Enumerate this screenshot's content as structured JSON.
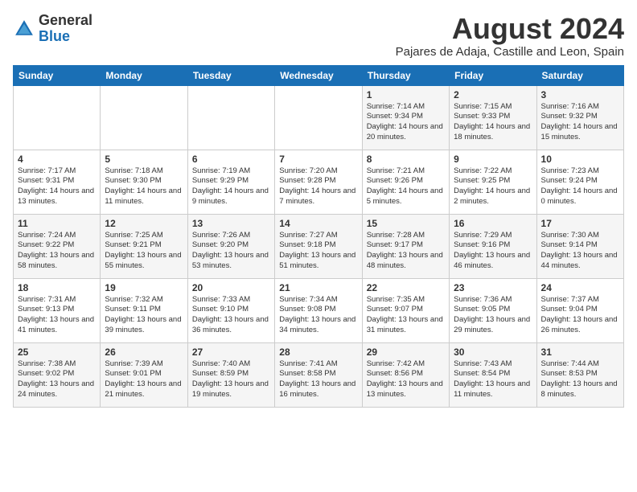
{
  "header": {
    "logo_general": "General",
    "logo_blue": "Blue",
    "month_year": "August 2024",
    "location": "Pajares de Adaja, Castille and Leon, Spain"
  },
  "weekdays": [
    "Sunday",
    "Monday",
    "Tuesday",
    "Wednesday",
    "Thursday",
    "Friday",
    "Saturday"
  ],
  "weeks": [
    [
      {
        "day": "",
        "info": ""
      },
      {
        "day": "",
        "info": ""
      },
      {
        "day": "",
        "info": ""
      },
      {
        "day": "",
        "info": ""
      },
      {
        "day": "1",
        "info": "Sunrise: 7:14 AM\nSunset: 9:34 PM\nDaylight: 14 hours and 20 minutes."
      },
      {
        "day": "2",
        "info": "Sunrise: 7:15 AM\nSunset: 9:33 PM\nDaylight: 14 hours and 18 minutes."
      },
      {
        "day": "3",
        "info": "Sunrise: 7:16 AM\nSunset: 9:32 PM\nDaylight: 14 hours and 15 minutes."
      }
    ],
    [
      {
        "day": "4",
        "info": "Sunrise: 7:17 AM\nSunset: 9:31 PM\nDaylight: 14 hours and 13 minutes."
      },
      {
        "day": "5",
        "info": "Sunrise: 7:18 AM\nSunset: 9:30 PM\nDaylight: 14 hours and 11 minutes."
      },
      {
        "day": "6",
        "info": "Sunrise: 7:19 AM\nSunset: 9:29 PM\nDaylight: 14 hours and 9 minutes."
      },
      {
        "day": "7",
        "info": "Sunrise: 7:20 AM\nSunset: 9:28 PM\nDaylight: 14 hours and 7 minutes."
      },
      {
        "day": "8",
        "info": "Sunrise: 7:21 AM\nSunset: 9:26 PM\nDaylight: 14 hours and 5 minutes."
      },
      {
        "day": "9",
        "info": "Sunrise: 7:22 AM\nSunset: 9:25 PM\nDaylight: 14 hours and 2 minutes."
      },
      {
        "day": "10",
        "info": "Sunrise: 7:23 AM\nSunset: 9:24 PM\nDaylight: 14 hours and 0 minutes."
      }
    ],
    [
      {
        "day": "11",
        "info": "Sunrise: 7:24 AM\nSunset: 9:22 PM\nDaylight: 13 hours and 58 minutes."
      },
      {
        "day": "12",
        "info": "Sunrise: 7:25 AM\nSunset: 9:21 PM\nDaylight: 13 hours and 55 minutes."
      },
      {
        "day": "13",
        "info": "Sunrise: 7:26 AM\nSunset: 9:20 PM\nDaylight: 13 hours and 53 minutes."
      },
      {
        "day": "14",
        "info": "Sunrise: 7:27 AM\nSunset: 9:18 PM\nDaylight: 13 hours and 51 minutes."
      },
      {
        "day": "15",
        "info": "Sunrise: 7:28 AM\nSunset: 9:17 PM\nDaylight: 13 hours and 48 minutes."
      },
      {
        "day": "16",
        "info": "Sunrise: 7:29 AM\nSunset: 9:16 PM\nDaylight: 13 hours and 46 minutes."
      },
      {
        "day": "17",
        "info": "Sunrise: 7:30 AM\nSunset: 9:14 PM\nDaylight: 13 hours and 44 minutes."
      }
    ],
    [
      {
        "day": "18",
        "info": "Sunrise: 7:31 AM\nSunset: 9:13 PM\nDaylight: 13 hours and 41 minutes."
      },
      {
        "day": "19",
        "info": "Sunrise: 7:32 AM\nSunset: 9:11 PM\nDaylight: 13 hours and 39 minutes."
      },
      {
        "day": "20",
        "info": "Sunrise: 7:33 AM\nSunset: 9:10 PM\nDaylight: 13 hours and 36 minutes."
      },
      {
        "day": "21",
        "info": "Sunrise: 7:34 AM\nSunset: 9:08 PM\nDaylight: 13 hours and 34 minutes."
      },
      {
        "day": "22",
        "info": "Sunrise: 7:35 AM\nSunset: 9:07 PM\nDaylight: 13 hours and 31 minutes."
      },
      {
        "day": "23",
        "info": "Sunrise: 7:36 AM\nSunset: 9:05 PM\nDaylight: 13 hours and 29 minutes."
      },
      {
        "day": "24",
        "info": "Sunrise: 7:37 AM\nSunset: 9:04 PM\nDaylight: 13 hours and 26 minutes."
      }
    ],
    [
      {
        "day": "25",
        "info": "Sunrise: 7:38 AM\nSunset: 9:02 PM\nDaylight: 13 hours and 24 minutes."
      },
      {
        "day": "26",
        "info": "Sunrise: 7:39 AM\nSunset: 9:01 PM\nDaylight: 13 hours and 21 minutes."
      },
      {
        "day": "27",
        "info": "Sunrise: 7:40 AM\nSunset: 8:59 PM\nDaylight: 13 hours and 19 minutes."
      },
      {
        "day": "28",
        "info": "Sunrise: 7:41 AM\nSunset: 8:58 PM\nDaylight: 13 hours and 16 minutes."
      },
      {
        "day": "29",
        "info": "Sunrise: 7:42 AM\nSunset: 8:56 PM\nDaylight: 13 hours and 13 minutes."
      },
      {
        "day": "30",
        "info": "Sunrise: 7:43 AM\nSunset: 8:54 PM\nDaylight: 13 hours and 11 minutes."
      },
      {
        "day": "31",
        "info": "Sunrise: 7:44 AM\nSunset: 8:53 PM\nDaylight: 13 hours and 8 minutes."
      }
    ]
  ]
}
